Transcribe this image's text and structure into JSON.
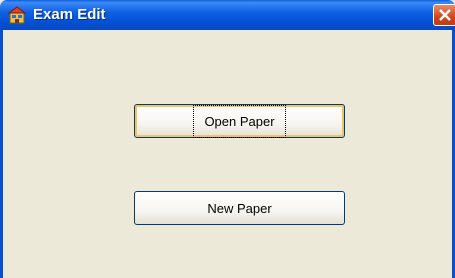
{
  "window": {
    "title": "Exam Edit",
    "close_symbol": "✕",
    "icon": "app-icon"
  },
  "buttons": {
    "open_paper": "Open Paper",
    "new_paper": "New Paper"
  },
  "colors": {
    "titlebar": "#0452d6",
    "background": "#ece9d8",
    "close": "#d4431c",
    "button_border": "#003c74"
  }
}
